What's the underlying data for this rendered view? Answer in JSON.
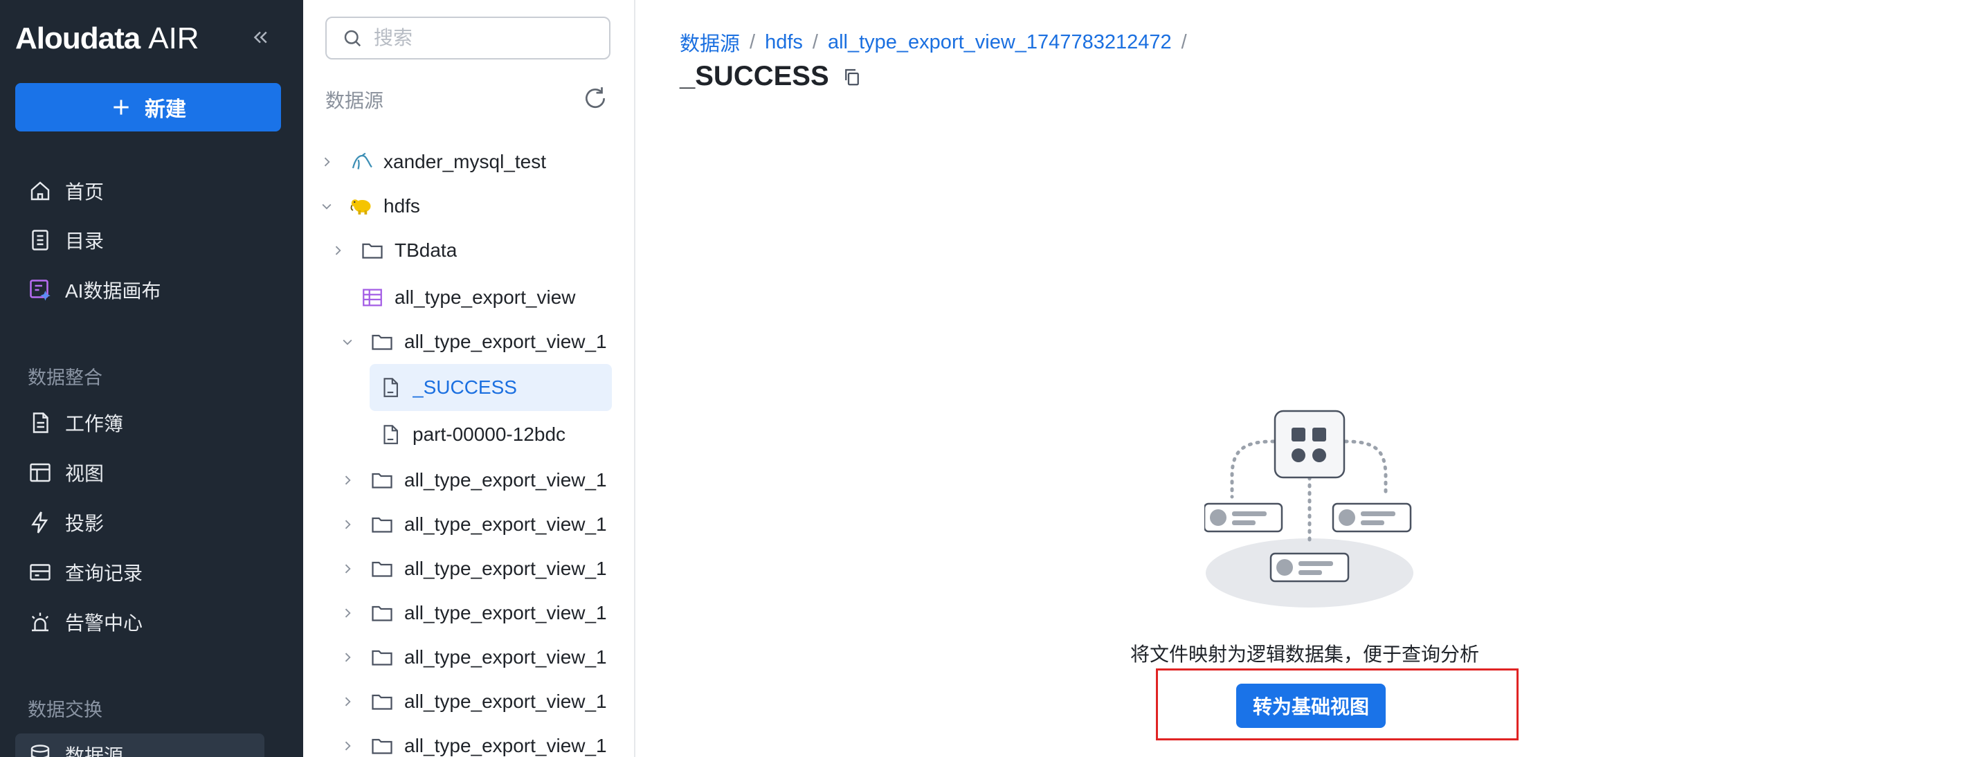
{
  "nav": {
    "logo_brand": "Aloudata",
    "logo_product": "AIR",
    "new_label": "新建",
    "items_top": [
      {
        "label": "首页",
        "icon": "home-icon"
      },
      {
        "label": "目录",
        "icon": "catalog-icon"
      },
      {
        "label": "AI数据画布",
        "icon": "ai-canvas-icon"
      }
    ],
    "section_integration": "数据整合",
    "items_integration": [
      {
        "label": "工作簿",
        "icon": "workbook-icon"
      },
      {
        "label": "视图",
        "icon": "view-icon"
      },
      {
        "label": "投影",
        "icon": "projection-icon"
      },
      {
        "label": "查询记录",
        "icon": "query-history-icon"
      },
      {
        "label": "告警中心",
        "icon": "alert-icon"
      }
    ],
    "section_exchange": "数据交换",
    "items_exchange": [
      {
        "label": "数据源",
        "icon": "datasource-icon",
        "active": true
      }
    ]
  },
  "tree": {
    "search_placeholder": "搜索",
    "header": "数据源",
    "rows": [
      {
        "label": "xander_mysql_test",
        "icon": "mysql-icon",
        "expanded": false
      },
      {
        "label": "hdfs",
        "icon": "hadoop-icon",
        "expanded": true
      },
      {
        "label": "TBdata",
        "icon": "folder-icon",
        "expanded": false
      },
      {
        "label": "all_type_export_view",
        "icon": "table-icon"
      },
      {
        "label": "all_type_export_view_1",
        "icon": "folder-icon",
        "expanded": true
      },
      {
        "label": "_SUCCESS",
        "icon": "file-icon",
        "selected": true
      },
      {
        "label": "part-00000-12bdc",
        "icon": "file-icon"
      },
      {
        "label": "all_type_export_view_1",
        "icon": "folder-icon",
        "expanded": false
      },
      {
        "label": "all_type_export_view_1",
        "icon": "folder-icon",
        "expanded": false
      },
      {
        "label": "all_type_export_view_1",
        "icon": "folder-icon",
        "expanded": false
      },
      {
        "label": "all_type_export_view_1",
        "icon": "folder-icon",
        "expanded": false
      },
      {
        "label": "all_type_export_view_1",
        "icon": "folder-icon",
        "expanded": false
      },
      {
        "label": "all_type_export_view_1",
        "icon": "folder-icon",
        "expanded": false
      },
      {
        "label": "all_type_export_view_1",
        "icon": "folder-icon",
        "expanded": false
      }
    ]
  },
  "main": {
    "breadcrumb": [
      "数据源",
      "hdfs",
      "all_type_export_view_1747783212472"
    ],
    "breadcrumb_sep": "/",
    "title": "_SUCCESS",
    "hint": "将文件映射为逻辑数据集，便于查询分析",
    "convert_label": "转为基础视图"
  },
  "colors": {
    "nav_bg": "#1f2833",
    "accent": "#1a73e8",
    "link": "#1a6fe0",
    "selected_bg": "#e8f1fd",
    "highlight_border": "#e02424"
  }
}
